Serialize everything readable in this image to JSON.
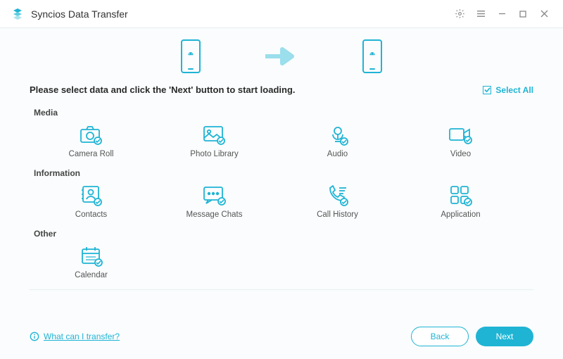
{
  "app": {
    "title": "Syncios Data Transfer"
  },
  "banner": {
    "source_os": "android",
    "target_os": "android"
  },
  "instruction": "Please select data and click the 'Next' button to start loading.",
  "select_all": {
    "label": "Select All",
    "checked": true
  },
  "sections": {
    "media": {
      "label": "Media",
      "items": [
        {
          "label": "Camera Roll",
          "icon": "camera"
        },
        {
          "label": "Photo Library",
          "icon": "photo"
        },
        {
          "label": "Audio",
          "icon": "audio"
        },
        {
          "label": "Video",
          "icon": "video"
        }
      ]
    },
    "information": {
      "label": "Information",
      "items": [
        {
          "label": "Contacts",
          "icon": "contacts"
        },
        {
          "label": "Message Chats",
          "icon": "message"
        },
        {
          "label": "Call History",
          "icon": "callhistory"
        },
        {
          "label": "Application",
          "icon": "apps"
        }
      ]
    },
    "other": {
      "label": "Other",
      "items": [
        {
          "label": "Calendar",
          "icon": "calendar"
        }
      ]
    }
  },
  "help": {
    "label": "What can I transfer?"
  },
  "buttons": {
    "back": "Back",
    "next": "Next"
  }
}
